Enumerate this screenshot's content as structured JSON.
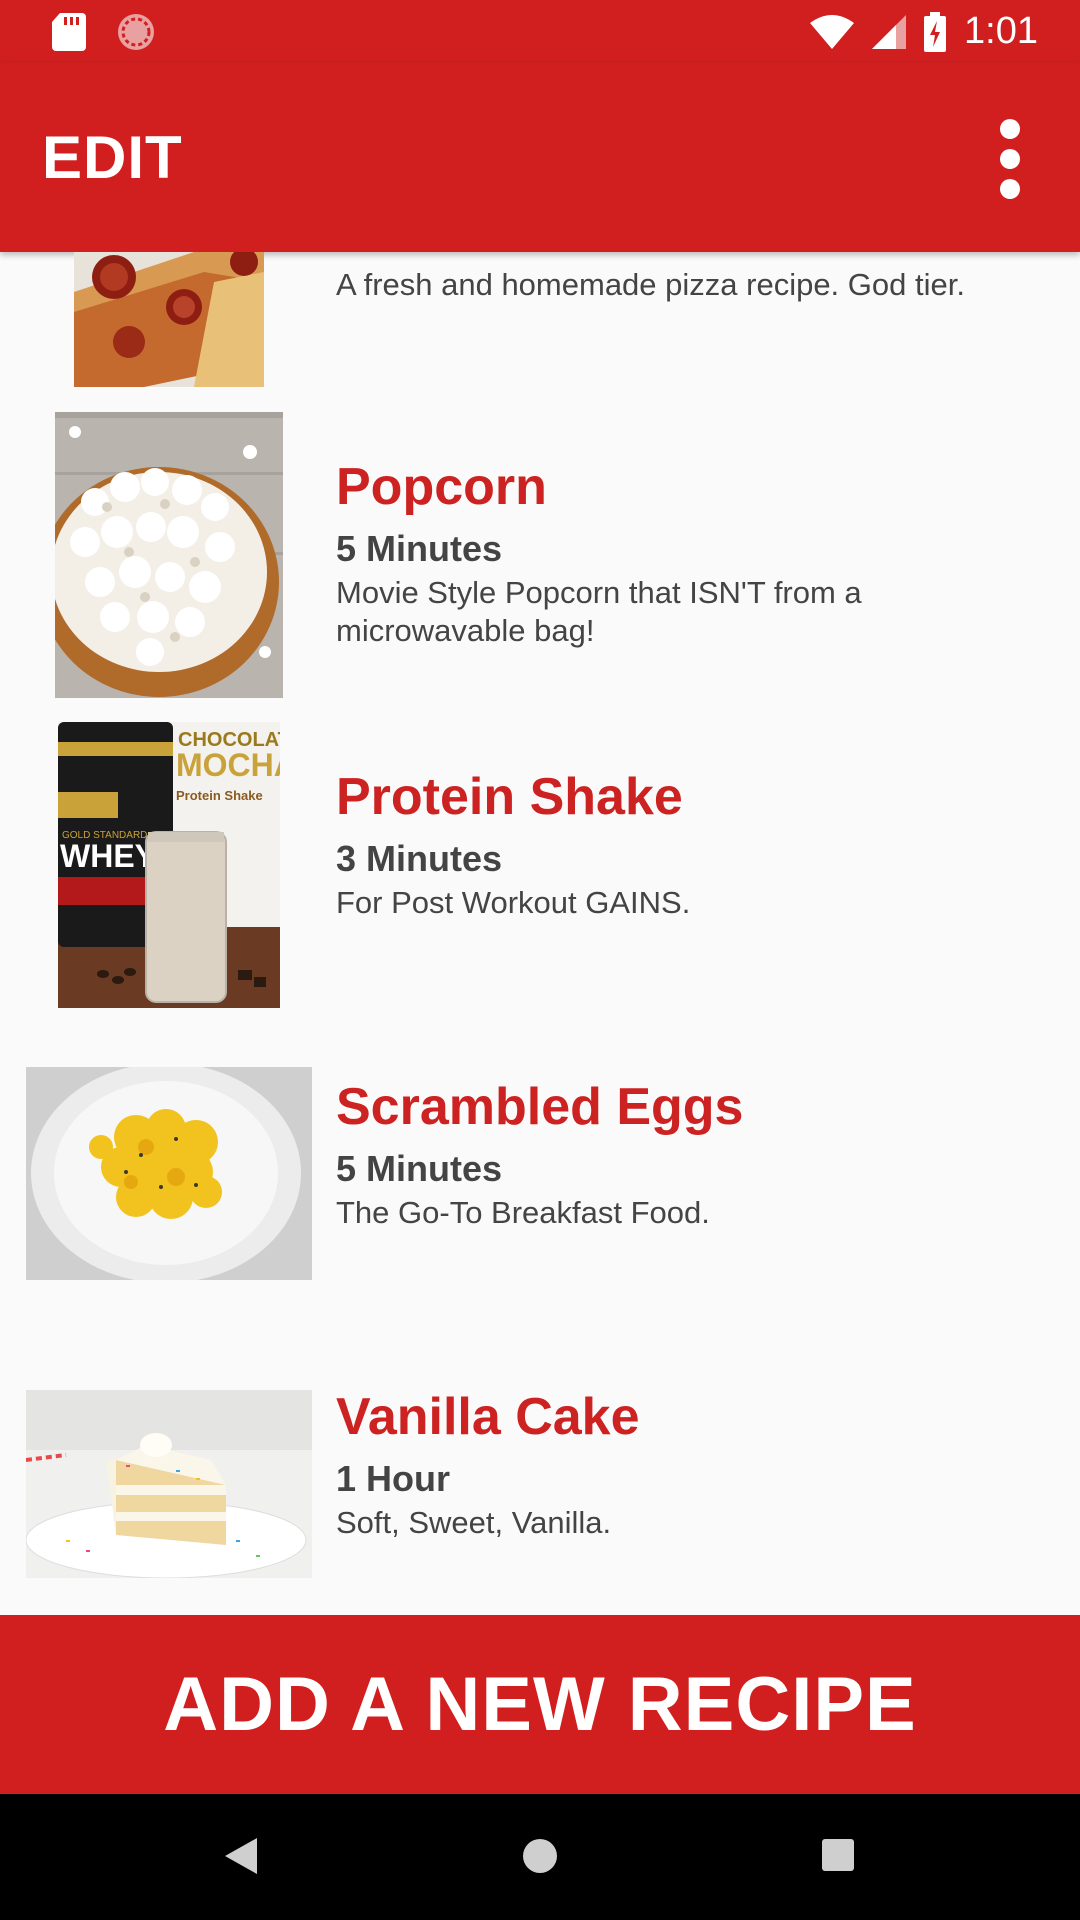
{
  "status_bar": {
    "time": "1:01",
    "icons": [
      "sd-card-icon",
      "sync-icon",
      "wifi-icon",
      "cell-signal-icon",
      "battery-charging-icon"
    ]
  },
  "app_bar": {
    "title": "EDIT",
    "menu_icon": "more-vert-icon"
  },
  "recipes": [
    {
      "title": "",
      "time": "",
      "description": "A fresh and homemade pizza recipe. God tier.",
      "image": "pizza"
    },
    {
      "title": "Popcorn",
      "time": "5 Minutes",
      "description": "Movie Style Popcorn that ISN'T from a microwavable bag!",
      "image": "popcorn"
    },
    {
      "title": "Protein Shake",
      "time": "3 Minutes",
      "description": "For Post Workout GAINS.",
      "image": "protein-shake",
      "image_text": [
        "CHOCOLATE",
        "MOCHA",
        "Protein Shake",
        "WHEY",
        "GOLD STANDARD"
      ]
    },
    {
      "title": "Scrambled Eggs",
      "time": "5 Minutes",
      "description": "The Go-To Breakfast Food.",
      "image": "scrambled-eggs"
    },
    {
      "title": "Vanilla Cake",
      "time": "1 Hour",
      "description": "Soft, Sweet, Vanilla.",
      "image": "vanilla-cake"
    }
  ],
  "add_button": {
    "label": "ADD A NEW RECIPE"
  },
  "colors": {
    "primary": "#d11f20",
    "title_red": "#cc2222",
    "text_dark": "#444444",
    "background": "#fafafa"
  },
  "nav_bar": {
    "icons": [
      "back-icon",
      "home-icon",
      "recents-icon"
    ]
  }
}
